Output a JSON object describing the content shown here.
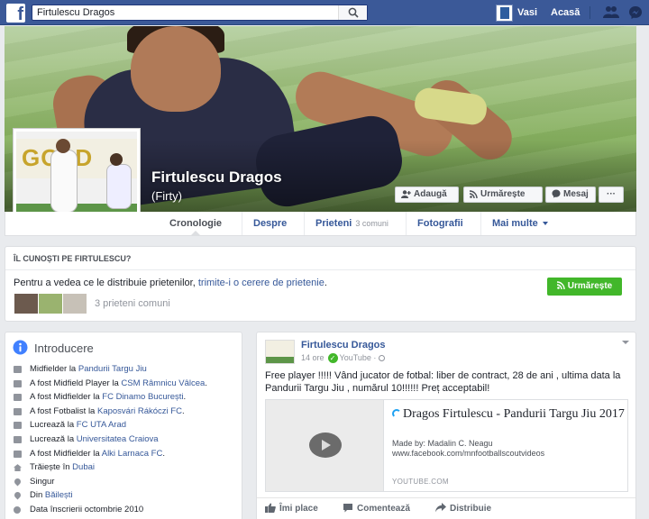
{
  "topbar": {
    "logo": "f",
    "search_value": "Firtulescu Dragos",
    "user_name": "Vasi",
    "home_label": "Acasă",
    "icons": [
      "search-icon",
      "friend-requests-icon",
      "messenger-icon"
    ]
  },
  "profile": {
    "name": "Firtulescu Dragos",
    "nickname": "(Firty)",
    "profile_pic_text": "GOLD",
    "buttons": {
      "add": "Adaugă",
      "follow": "Urmărește",
      "message": "Mesaj",
      "more": "···"
    }
  },
  "tabs": {
    "timeline": "Cronologie",
    "about": "Despre",
    "friends": "Prieteni",
    "friends_count": "3 comuni",
    "photos": "Fotografii",
    "more": "Mai multe"
  },
  "know": {
    "heading": "ÎL CUNOȘTI PE FIRTULESCU?",
    "text_prefix": "Pentru a vedea ce le distribuie prietenilor, ",
    "text_link": "trimite-i o cerere de prietenie",
    "text_suffix": ".",
    "follow_button": "Urmărește",
    "mutual_friends": "3 prieteni comuni"
  },
  "intro": {
    "title": "Introducere",
    "items": [
      {
        "icon": "briefcase-icon",
        "prefix": "Midfielder la ",
        "link": "Pandurii Targu Jiu",
        "suffix": ""
      },
      {
        "icon": "briefcase-icon",
        "prefix": "A fost Midfield Player la ",
        "link": "CSM Râmnicu Vâlcea",
        "suffix": "."
      },
      {
        "icon": "briefcase-icon",
        "prefix": "A fost Midfielder la ",
        "link": "FC Dinamo București",
        "suffix": "."
      },
      {
        "icon": "briefcase-icon",
        "prefix": "A fost Fotbalist la ",
        "link": "Kaposvári Rákóczi FC",
        "suffix": "."
      },
      {
        "icon": "briefcase-icon",
        "prefix": "Lucrează la ",
        "link": "FC UTA Arad",
        "suffix": ""
      },
      {
        "icon": "graduation-icon",
        "prefix": "Lucrează la ",
        "link": "Universitatea Craiova",
        "suffix": ""
      },
      {
        "icon": "briefcase-icon",
        "prefix": "A fost Midfielder la ",
        "link": "Alki Larnaca FC",
        "suffix": "."
      },
      {
        "icon": "house-icon",
        "prefix": "Trăiește în ",
        "link": "Dubai",
        "suffix": ""
      },
      {
        "icon": "heart-icon",
        "prefix": "Singur",
        "link": "",
        "suffix": ""
      },
      {
        "icon": "location-pin-icon",
        "prefix": "Din ",
        "link": "Băilești",
        "suffix": ""
      },
      {
        "icon": "clock-icon",
        "prefix": "Data înscrierii octombrie 2010",
        "link": "",
        "suffix": ""
      }
    ]
  },
  "post": {
    "author": "Firtulescu Dragos",
    "time": "14 ore",
    "source": "YouTube",
    "source_sep": "·",
    "text": "Free player !!!!! Vând jucator de fotbal: liber de contract, 28 de ani , ultima data la Pandurii Targu Jiu , numărul 10!!!!!! Preț acceptabil!",
    "link": {
      "title": "Dragos Firtulescu - Pandurii Targu Jiu 2017",
      "made_by": "Made by: Madalin C. Neagu",
      "url": "www.facebook.com/mnfootballscoutvideos",
      "domain": "YOUTUBE.COM"
    },
    "actions": {
      "like": "Îmi place",
      "comment": "Comentează",
      "share": "Distribuie"
    }
  },
  "colors": {
    "facebook_blue": "#3b5998",
    "link_blue": "#365899",
    "green": "#42b72a"
  }
}
